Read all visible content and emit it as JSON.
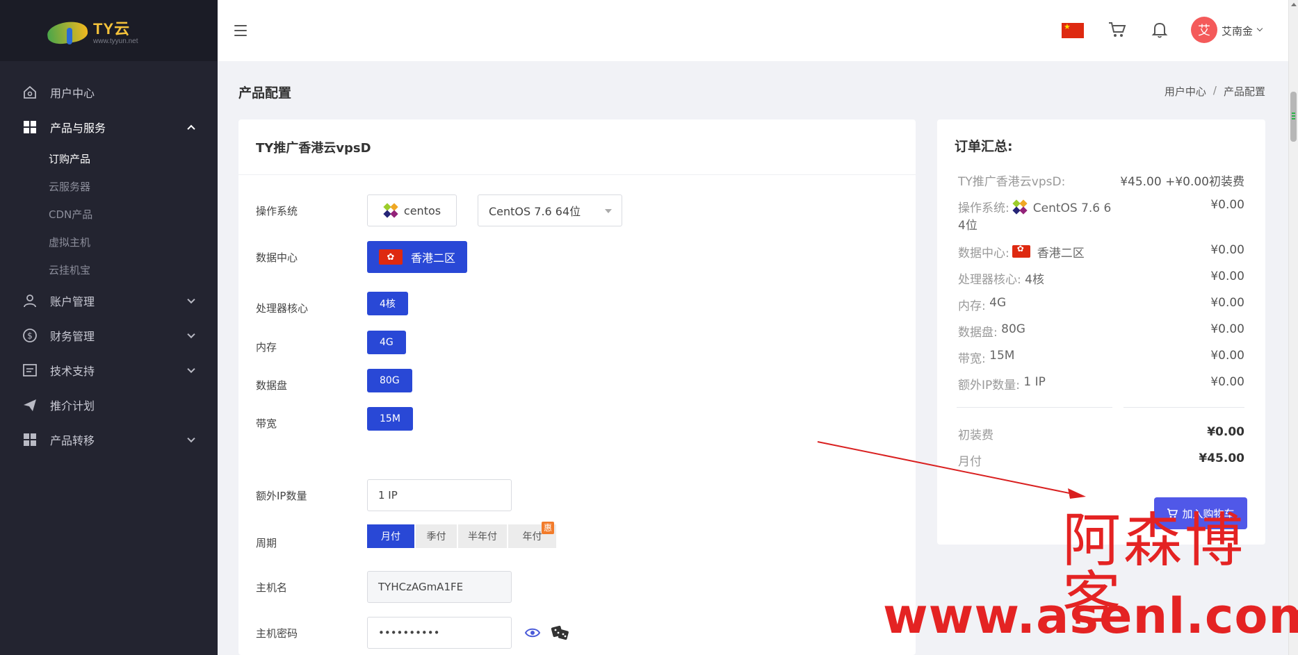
{
  "brand": {
    "title": "TY云",
    "url_text": "www.tyyun.net"
  },
  "sidebar": {
    "items": [
      {
        "label": "用户中心",
        "icon": "home-icon"
      },
      {
        "label": "产品与服务",
        "icon": "grid-icon",
        "expanded": true,
        "children": [
          "订购产品",
          "云服务器",
          "CDN产品",
          "虚拟主机",
          "云挂机宝"
        ]
      },
      {
        "label": "账户管理",
        "icon": "user-icon"
      },
      {
        "label": "财务管理",
        "icon": "dollar-icon"
      },
      {
        "label": "技术支持",
        "icon": "ticket-icon"
      },
      {
        "label": "推介计划",
        "icon": "paper-plane-icon"
      },
      {
        "label": "产品转移",
        "icon": "grid-icon"
      }
    ]
  },
  "header": {
    "username": "艾南金",
    "avatar_initial": "艾"
  },
  "page": {
    "title": "产品配置",
    "breadcrumb": [
      "用户中心",
      "/",
      "产品配置"
    ]
  },
  "config": {
    "product_name": "TY推广香港云vpsD",
    "os": {
      "label": "操作系统",
      "family": "centos",
      "version": "CentOS 7.6 64位"
    },
    "datacenter": {
      "label": "数据中心",
      "value": "香港二区"
    },
    "cpu": {
      "label": "处理器核心",
      "value": "4核"
    },
    "memory": {
      "label": "内存",
      "value": "4G"
    },
    "disk": {
      "label": "数据盘",
      "value": "80G"
    },
    "bandwidth": {
      "label": "带宽",
      "value": "15M"
    },
    "extra_ip": {
      "label": "额外IP数量",
      "value": "1 IP"
    },
    "period": {
      "label": "周期",
      "options": [
        "月付",
        "季付",
        "半年付",
        "年付"
      ],
      "selected": "月付",
      "badge": "惠"
    },
    "hostname": {
      "label": "主机名",
      "value": "TYHCzAGmA1FE"
    },
    "password": {
      "label": "主机密码",
      "value": "••••••••••"
    }
  },
  "summary": {
    "title": "订单汇总:",
    "product": {
      "label": "TY推广香港云vpsD:",
      "price": "¥45.00 +¥0.00初装费"
    },
    "os": {
      "label": "操作系统:",
      "value": "CentOS 7.6 6",
      "value2": "4位",
      "price": "¥0.00"
    },
    "datacenter": {
      "label": "数据中心:",
      "value": "香港二区",
      "price": "¥0.00"
    },
    "cpu": {
      "label": "处理器核心:",
      "value": "4核",
      "price": "¥0.00"
    },
    "memory": {
      "label": "内存:",
      "value": "4G",
      "price": "¥0.00"
    },
    "disk": {
      "label": "数据盘:",
      "value": "80G",
      "price": "¥0.00"
    },
    "bandwidth": {
      "label": "带宽:",
      "value": "15M",
      "price": "¥0.00"
    },
    "extra_ip": {
      "label": "额外IP数量:",
      "value": "1 IP",
      "price": "¥0.00"
    },
    "setup_fee": {
      "label": "初装费",
      "price": "¥0.00"
    },
    "monthly": {
      "label": "月付",
      "price": "¥45.00"
    },
    "add_to_cart": "加入购物车"
  },
  "watermark": {
    "cn": "阿森博客",
    "url": "www.asenl.com"
  },
  "colors": {
    "primary": "#2948d6",
    "cart_button": "#5058e8",
    "sidebar": "#232430",
    "watermark": "#e42323"
  }
}
